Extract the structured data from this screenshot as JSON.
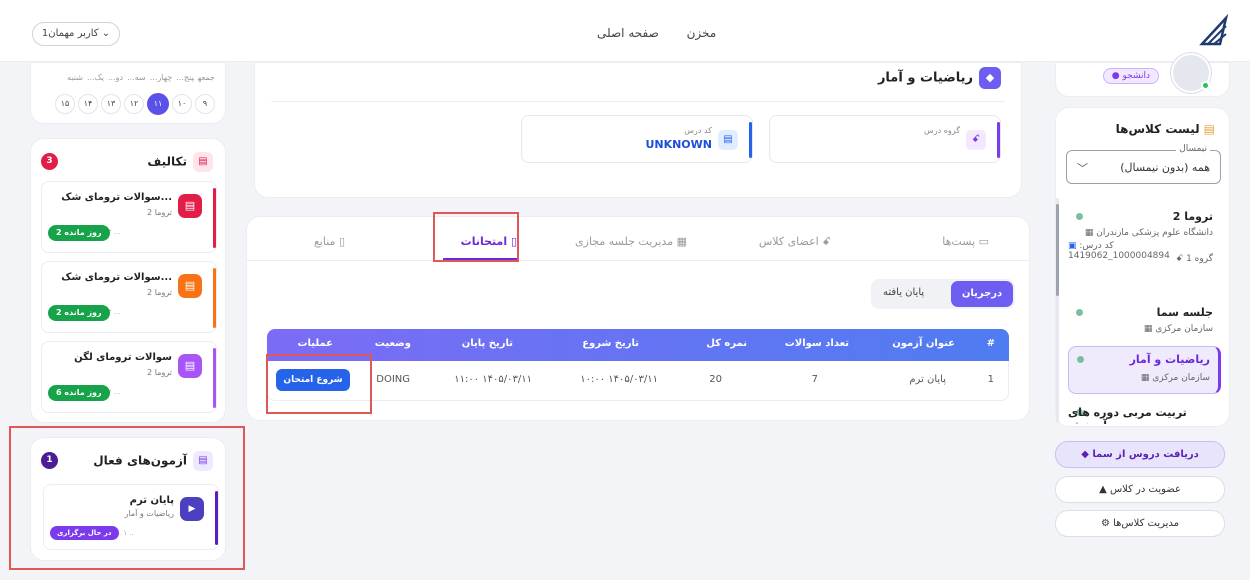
{
  "topbar": {
    "nav": [
      "صفحه اصلی",
      "مخزن"
    ],
    "user_label": "کاربر مهمان1 ⌄"
  },
  "profile": {
    "role": "دانشجو"
  },
  "class_list": {
    "title": "لیست کلاس‌ها",
    "semester_legend": "نیمسال",
    "semester_value": "همه (بدون نیمسال)",
    "items": [
      {
        "name": "تروما 2",
        "lines": [
          "دانشگاه علوم پزشکی مازندران",
          "کد درس: 1000004894_1419062",
          "گروه 1"
        ]
      },
      {
        "name": "جلسه سما",
        "lines": [
          "سازمان مرکزی"
        ]
      },
      {
        "name": "ریاضیات و آمار",
        "lines": [
          "سازمان مرکزی"
        ],
        "active": true
      },
      {
        "name": "تربیت مربی دوره های آموزش",
        "lines": []
      }
    ]
  },
  "side_buttons": [
    "دریافت دروس از سما",
    "عضویت در کلاس",
    "مدیریت کلاس‌ها"
  ],
  "course": {
    "title": "ریاضیات و آمار",
    "group_label": "گروه درس",
    "code_label": "کد درس",
    "code_value": "UNKNOWN"
  },
  "tabs": [
    "پست‌ها",
    "اعضای کلاس",
    "مدیریت جلسه مجازی",
    "امتحانات",
    "منابع"
  ],
  "segment": {
    "active": "درجریان",
    "inactive": "پایان یافته"
  },
  "table": {
    "headers": [
      "#",
      "عنوان آزمون",
      "تعداد سوالات",
      "نمره کل",
      "تاریخ شروع",
      "تاریخ پایان",
      "وضعیت",
      "عملیات"
    ],
    "row": {
      "index": "1",
      "title": "پایان ترم",
      "questions": "7",
      "score": "20",
      "start": "۱۰:۰۰ ۱۴۰۵/۰۳/۱۱",
      "end": "۱۱:۰۰ ۱۴۰۵/۰۳/۱۱",
      "status": "DOING",
      "action": "شروع امتحان"
    }
  },
  "calendar": {
    "days": [
      "شنبه",
      "یک...",
      "دو...",
      "سه...",
      "چهار...",
      "پنج...",
      "جمعه"
    ],
    "nums": [
      "۱۵",
      "۱۴",
      "۱۳",
      "۱۲",
      "۱۱",
      "۱۰",
      "۹"
    ]
  },
  "tasks": {
    "title": "تکالیف",
    "count": "3",
    "items": [
      {
        "name": "سوالات ترومای شک...",
        "sub": "تروما 2",
        "date": "۰۳/۱۳ ...",
        "due": "2 روز مانده",
        "color": "#e11d48"
      },
      {
        "name": "سوالات ترومای شک...",
        "sub": "تروما 2",
        "date": "۰۳/۱۳ ...",
        "due": "2 روز مانده",
        "color": "#f97316"
      },
      {
        "name": "سوالات ترومای لگن",
        "sub": "تروما 2",
        "date": "۰۳/۱۷ ...",
        "due": "6 روز مانده",
        "color": "#a855f7"
      }
    ]
  },
  "active_exams": {
    "title": "آزمون‌های فعال",
    "count": "1",
    "item": {
      "name": "پایان ترم",
      "sub": "ریاضیات و آمار",
      "date": "7 .. ۱ ..",
      "status": "در حال برگزاری"
    }
  },
  "colors": {
    "accent": "#6d5df0",
    "highlight": "#e15757",
    "primary_button": "#2563eb"
  }
}
